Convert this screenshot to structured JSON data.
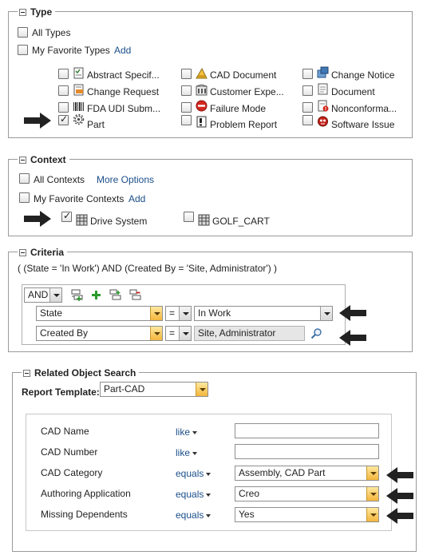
{
  "type_section": {
    "title": "Type",
    "all_types": "All Types",
    "my_favorite_types": "My Favorite Types",
    "add": "Add",
    "types": [
      {
        "label": "Abstract Specif...",
        "icon": "abstract-spec-icon",
        "checked": false
      },
      {
        "label": "CAD Document",
        "icon": "cad-document-icon",
        "checked": false
      },
      {
        "label": "Change Notice",
        "icon": "change-notice-icon",
        "checked": false
      },
      {
        "label": "Change Request",
        "icon": "change-request-icon",
        "checked": false
      },
      {
        "label": "Customer Expe...",
        "icon": "customer-experience-icon",
        "checked": false
      },
      {
        "label": "Document",
        "icon": "document-icon",
        "checked": false
      },
      {
        "label": "FDA UDI Subm...",
        "icon": "barcode-icon",
        "checked": false
      },
      {
        "label": "Failure Mode",
        "icon": "failure-mode-icon",
        "checked": false
      },
      {
        "label": "Nonconforma...",
        "icon": "nonconformance-icon",
        "checked": false
      },
      {
        "label": "Part",
        "icon": "gear-icon",
        "checked": true
      },
      {
        "label": "Problem Report",
        "icon": "problem-report-icon",
        "checked": false
      },
      {
        "label": "Software Issue",
        "icon": "bug-icon",
        "checked": false
      }
    ]
  },
  "context_section": {
    "title": "Context",
    "all_contexts": "All Contexts",
    "more_options": "More Options",
    "my_favorite_contexts": "My Favorite Contexts",
    "add": "Add",
    "contexts": [
      {
        "label": "Drive System",
        "checked": true
      },
      {
        "label": "GOLF_CART",
        "checked": false
      }
    ]
  },
  "criteria_section": {
    "title": "Criteria",
    "expression": "( (State = 'In Work') AND (Created By = 'Site, Administrator') )",
    "logic_operator": "AND",
    "rows": [
      {
        "attribute": "State",
        "operator": "=",
        "value": "In Work"
      },
      {
        "attribute": "Created By",
        "operator": "=",
        "value": "Site, Administrator"
      }
    ]
  },
  "related_section": {
    "title": "Related Object Search",
    "report_template_label": "Report Template:",
    "report_template_value": "Part-CAD",
    "rows": [
      {
        "label": "CAD Name",
        "operator": "like",
        "value": ""
      },
      {
        "label": "CAD Number",
        "operator": "like",
        "value": ""
      },
      {
        "label": "CAD Category",
        "operator": "equals",
        "value": "Assembly, CAD Part"
      },
      {
        "label": "Authoring Application",
        "operator": "equals",
        "value": "Creo"
      },
      {
        "label": "Missing Dependents",
        "operator": "equals",
        "value": "Yes"
      }
    ]
  },
  "colors": {
    "link": "#1a4e8a",
    "accent_orange": "#f3b63c",
    "arrow": "#222222"
  }
}
